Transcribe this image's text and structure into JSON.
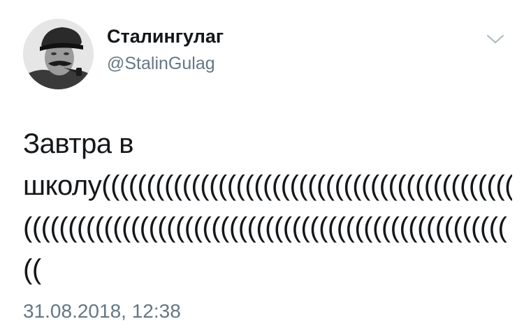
{
  "author": {
    "display_name": "Сталингулаг",
    "handle": "@StalinGulag",
    "avatar_icon": "stalin-portrait-avatar"
  },
  "menu": {
    "icon": "chevron-down-icon"
  },
  "tweet": {
    "lines": [
      "Завтра в",
      "школу(((((((((((((((((((((((((((((((((((((((((((((((",
      "((((((((((((((((((((((((((((((((((((((((((((((((((((((",
      "(("
    ],
    "timestamp": "31.08.2018, 12:38"
  },
  "colors": {
    "text_primary": "#14171a",
    "text_secondary": "#657786",
    "chevron": "#aab8c2"
  }
}
